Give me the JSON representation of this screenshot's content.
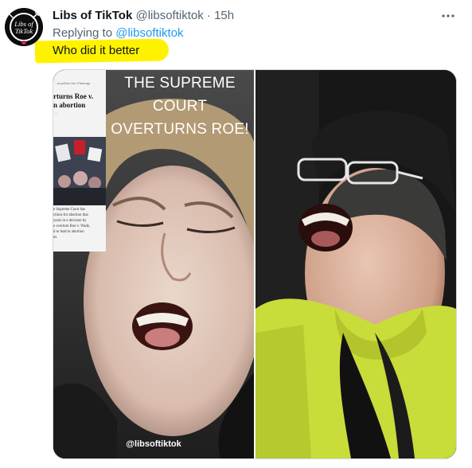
{
  "author": {
    "avatar_text_line1": "Libs of",
    "avatar_text_line2": "TikTok",
    "name": "Libs of TikTok",
    "handle": "@libsoftiktok",
    "separator": "·",
    "timestamp": "15h"
  },
  "more_icon": "more-dots-icon",
  "reply": {
    "prefix": "Replying to",
    "handle": "@libsoftiktok"
  },
  "tweet_text": "Who did it better",
  "highlight_color": "#fff200",
  "link_color": "#1d9bf0",
  "media": {
    "left": {
      "caption_line1": "THE SUPREME COURT",
      "caption_line2": "OVERTURNS ROE!",
      "watermark": "@libsoftiktok",
      "article_top": "...rn politics   Jun. 8 hearings",
      "article_headline": "rturns Roe v.\nn abortion",
      "article_byline": "...",
      "article_body": "e Supreme Court has\nctions for abortion that\n years in a decision by\ne overturn Roe v. Wade,\nd to lead to abortion\nes."
    },
    "right": {
      "description_hidden": ""
    }
  }
}
